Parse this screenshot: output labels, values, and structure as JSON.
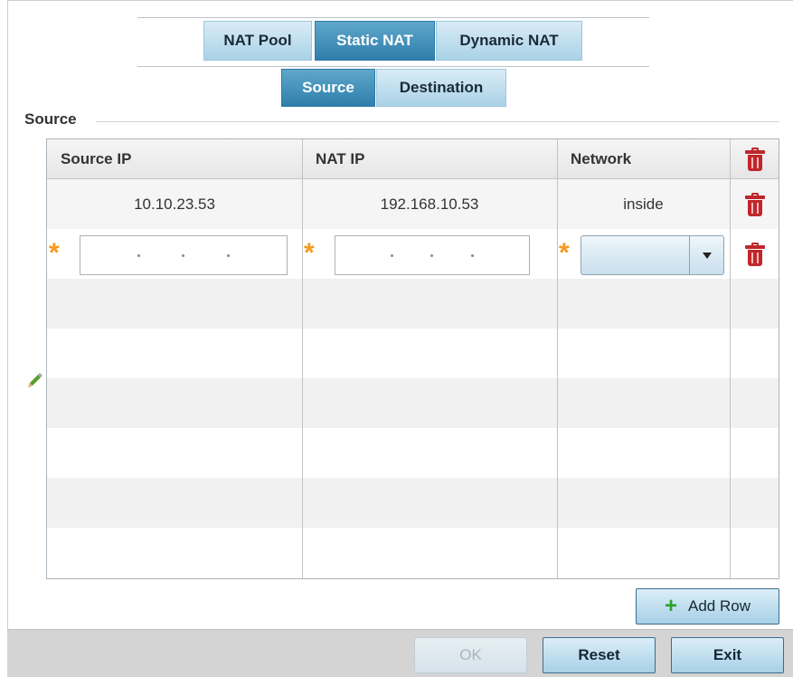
{
  "tabs_primary": [
    {
      "label": "NAT Pool",
      "active": false
    },
    {
      "label": "Static NAT",
      "active": true
    },
    {
      "label": "Dynamic NAT",
      "active": false
    }
  ],
  "tabs_secondary": [
    {
      "label": "Source",
      "active": true
    },
    {
      "label": "Destination",
      "active": false
    }
  ],
  "section": {
    "label": "Source"
  },
  "table": {
    "headers": [
      "Source IP",
      "NAT IP",
      "Network"
    ],
    "rows": [
      {
        "source_ip": "10.10.23.53",
        "nat_ip": "192.168.10.53",
        "network": "inside"
      }
    ],
    "new_row": {
      "source_ip": "",
      "nat_ip": "",
      "network": ""
    }
  },
  "buttons": {
    "add_row": "Add Row",
    "ok": "OK",
    "reset": "Reset",
    "exit": "Exit"
  },
  "icons": {
    "delete": "trash-icon",
    "edit": "pencil-icon",
    "add": "plus-icon",
    "required": "asterisk-icon"
  },
  "colors": {
    "tab_active": "#2f7eab",
    "tab_inactive": "#a9d2e7",
    "delete": "#c0262b",
    "required": "#f39a1e",
    "add": "#2aa12a"
  }
}
